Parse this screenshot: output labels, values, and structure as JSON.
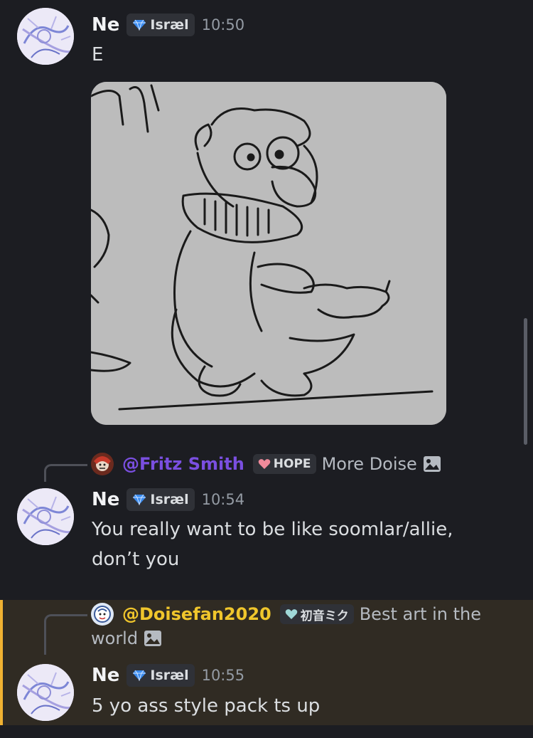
{
  "colors": {
    "background": "#1c1d22",
    "highlight": "#302b23",
    "highlight_bar": "#f0b232",
    "fritz_name": "#7a4fe0",
    "doise_name": "#f0c62c"
  },
  "messages": [
    {
      "username": "Ne",
      "tag_icon": "diamond-icon",
      "tag": "Isræl",
      "time": "10:50",
      "lines": [
        "E"
      ],
      "attachment": "image"
    },
    {
      "reply": {
        "mention": "@Fritz Smith",
        "tag_icon": "heart-icon",
        "tag": "HOPE",
        "text": "More Doise",
        "attachment_icon": "image-icon"
      },
      "username": "Ne",
      "tag_icon": "diamond-icon",
      "tag": "Isræl",
      "time": "10:54",
      "lines": [
        "You really want to be like soomlar/allie,",
        "don’t you"
      ]
    },
    {
      "reply": {
        "mention": "@Doisefan2020",
        "tag_icon": "heart-icon",
        "tag": "初音ミク",
        "text_line1": "Best art in the",
        "text_line2": "world",
        "attachment_icon": "image-icon"
      },
      "username": "Ne",
      "tag_icon": "diamond-icon",
      "tag": "Isræl",
      "time": "10:55",
      "lines": [
        "5 yo ass style pack ts up"
      ],
      "highlighted": true
    }
  ]
}
